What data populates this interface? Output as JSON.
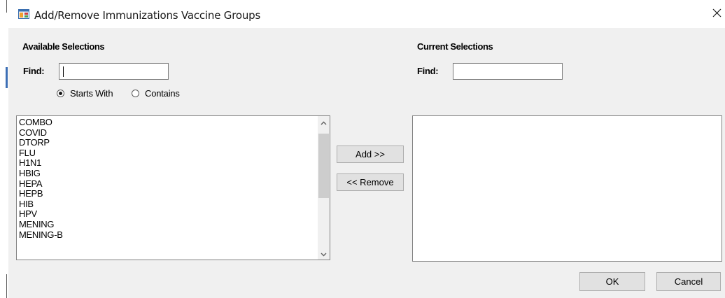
{
  "window": {
    "title": "Add/Remove Immunizations Vaccine Groups",
    "close_glyph": "✕",
    "icon": "app-window-icon"
  },
  "available": {
    "title": "Available Selections",
    "find_label": "Find:",
    "find_value": "",
    "radio_options": [
      {
        "label": "Starts With",
        "selected": true
      },
      {
        "label": "Contains",
        "selected": false
      }
    ],
    "items": [
      "COMBO",
      "COVID",
      "DTORP",
      "FLU",
      "H1N1",
      "HBIG",
      "HEPA",
      "HEPB",
      "HIB",
      "HPV",
      "MENING",
      "MENING-B"
    ]
  },
  "current": {
    "title": "Current Selections",
    "find_label": "Find:",
    "find_value": "",
    "items": []
  },
  "buttons": {
    "add": "Add >>",
    "remove": "<< Remove",
    "ok": "OK",
    "cancel": "Cancel"
  }
}
